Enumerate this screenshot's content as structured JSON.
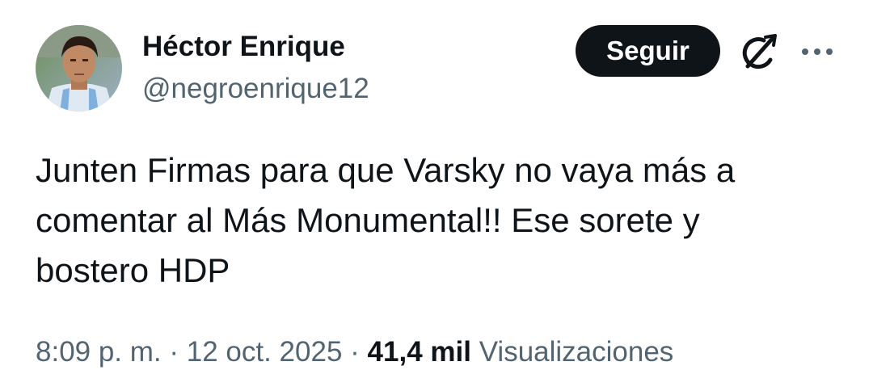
{
  "author": {
    "display_name": "Héctor Enrique",
    "handle": "@negroenrique12"
  },
  "actions": {
    "follow_label": "Seguir",
    "grok_icon": "grok-icon",
    "more_icon": "more-icon"
  },
  "tweet": {
    "text": "Junten Firmas para que Varsky no vaya más a\ncomentar al Más Monumental!! Ese sorete y\nbostero HDP"
  },
  "meta": {
    "time": "8:09 p. m.",
    "separator": "·",
    "date": "12 oct. 2025",
    "views_count": "41,4 mil",
    "views_label": "Visualizaciones"
  },
  "colors": {
    "text": "#0f1419",
    "secondary": "#536471",
    "button_bg": "#0f1419",
    "button_text": "#ffffff"
  }
}
